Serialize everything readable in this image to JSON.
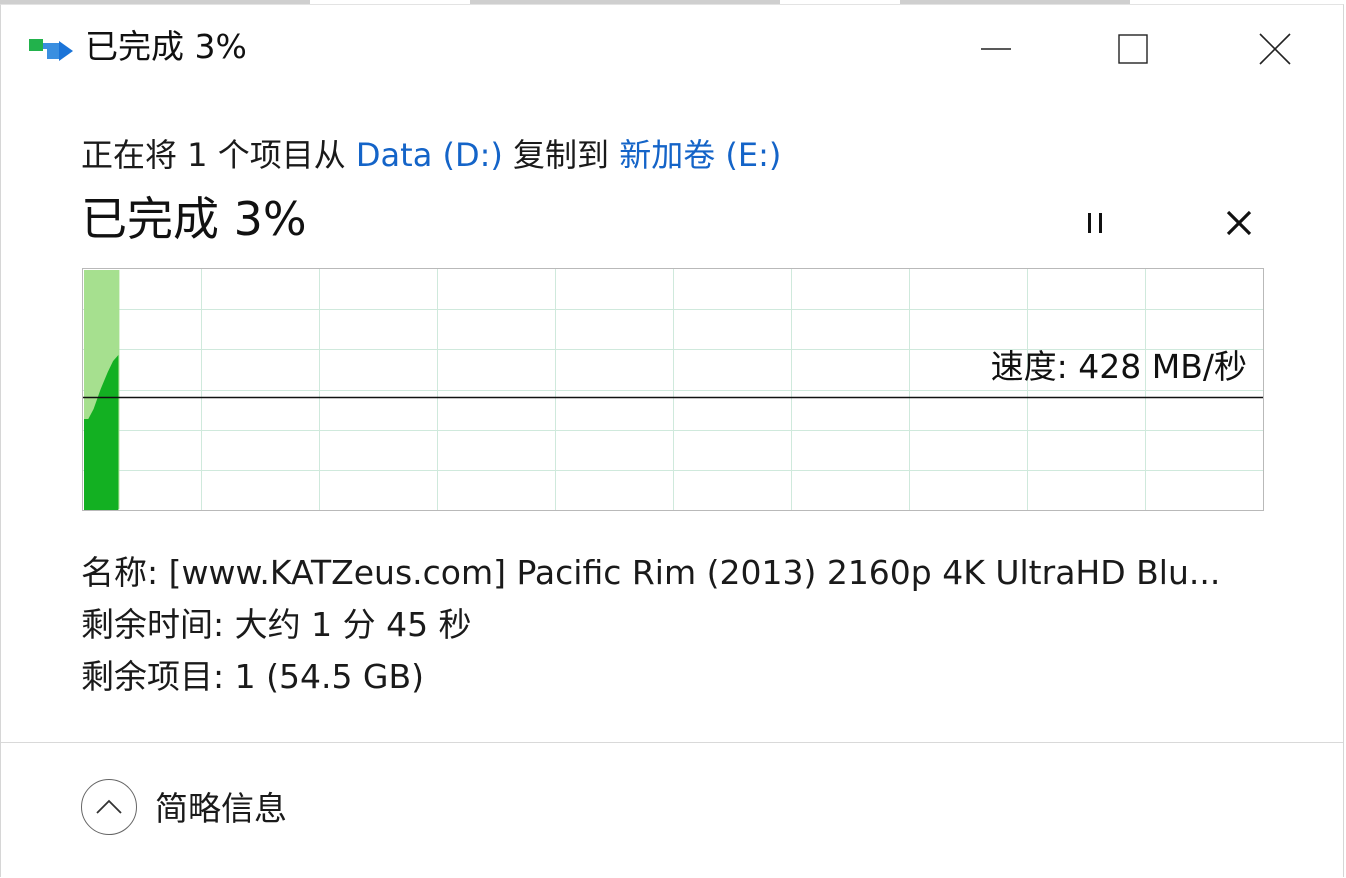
{
  "window": {
    "title": "已完成 3%"
  },
  "copy": {
    "prefix": "正在将 1 个项目从 ",
    "source": "Data (D:)",
    "middle": " 复制到 ",
    "destination": "新加卷 (E:)",
    "status": "已完成 3%",
    "progress_percent": 3
  },
  "graph": {
    "speed_label": "速度: 428 MB/秒",
    "speed_level_fraction": 0.47
  },
  "details": {
    "name_line": "名称:  [www.KATZeus.com] Pacific Rim (2013) 2160p 4K UltraHD Blu...",
    "time_line": "剩余时间: 大约 1 分 45 秒",
    "items_line": "剩余项目: 1 (54.5 GB)"
  },
  "footer": {
    "collapse_label": "简略信息"
  },
  "colors": {
    "accent_link": "#1464c8",
    "progress_fill": "#a6e08f",
    "speed_fill": "#13b022"
  },
  "icons": {
    "app": "file-copy-icon",
    "minimize": "minimize-icon",
    "maximize": "maximize-icon",
    "close": "close-icon",
    "pause": "pause-icon",
    "cancel": "cancel-icon",
    "collapse": "chevron-up-icon"
  }
}
